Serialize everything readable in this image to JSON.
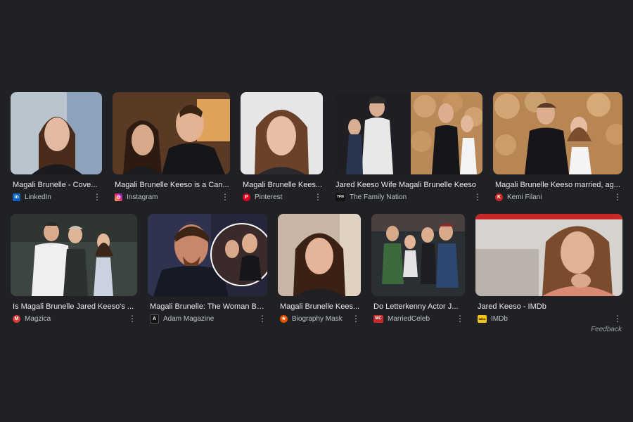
{
  "results": [
    {
      "title": "Magali Brunelle - Cove...",
      "source": "LinkedIn",
      "favicon": {
        "glyph": "in",
        "color": "#0a66c2"
      }
    },
    {
      "title": "Magali Brunelle Keeso is a Can...",
      "source": "Instagram",
      "favicon": {
        "glyph": "◎",
        "color": "#d6249f"
      }
    },
    {
      "title": "Magali Brunelle Kees...",
      "source": "Pinterest",
      "favicon": {
        "glyph": "P",
        "color": "#e60023"
      }
    },
    {
      "title": "Jared Keeso Wife Magali Brunelle Keeso",
      "source": "The Family Nation",
      "favicon": {
        "glyph": "TFN",
        "color": "#111111"
      }
    },
    {
      "title": "Magali Brunelle Keeso married, ag...",
      "source": "Kemi Filani",
      "favicon": {
        "glyph": "K",
        "color": "#c62828"
      }
    },
    {
      "title": "Is Magali Brunelle Jared Keeso's ...",
      "source": "Magzica",
      "favicon": {
        "glyph": "M",
        "color": "#e53935"
      }
    },
    {
      "title": "Magali Brunelle: The Woman Be...",
      "source": "Adam Magazine",
      "favicon": {
        "glyph": "A",
        "color": "#111111"
      }
    },
    {
      "title": "Magali Brunelle Kees...",
      "source": "Biography Mask",
      "favicon": {
        "glyph": "★",
        "color": "#e65100"
      }
    },
    {
      "title": "Do Letterkenny Actor J...",
      "source": "MarriedCeleb",
      "favicon": {
        "glyph": "MC",
        "color": "#c62828"
      }
    },
    {
      "title": "Jared Keeso - IMDb",
      "source": "IMDb",
      "favicon": {
        "glyph": "IMDb",
        "color": "#f5c518"
      }
    }
  ],
  "more_glyph": "⋮",
  "feedback_label": "Feedback"
}
